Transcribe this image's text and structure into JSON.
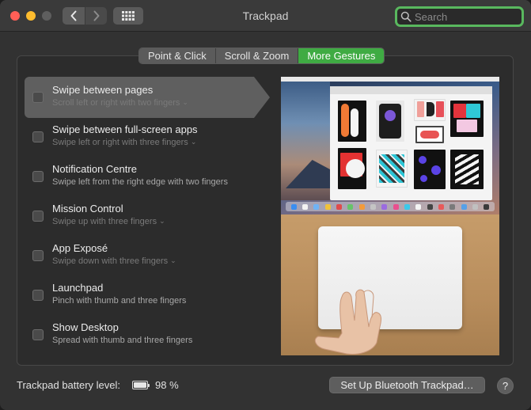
{
  "window": {
    "title": "Trackpad"
  },
  "search": {
    "placeholder": "Search"
  },
  "tabs": [
    {
      "label": "Point & Click",
      "active": false
    },
    {
      "label": "Scroll & Zoom",
      "active": false
    },
    {
      "label": "More Gestures",
      "active": true
    }
  ],
  "gestures": [
    {
      "title": "Swipe between pages",
      "subtitle": "Scroll left or right with two fingers",
      "dropdown": true,
      "selected": true,
      "checked": false
    },
    {
      "title": "Swipe between full-screen apps",
      "subtitle": "Swipe left or right with three fingers",
      "dropdown": true,
      "selected": false,
      "checked": false
    },
    {
      "title": "Notification Centre",
      "subtitle": "Swipe left from the right edge with two fingers",
      "dropdown": false,
      "selected": false,
      "checked": false
    },
    {
      "title": "Mission Control",
      "subtitle": "Swipe up with three fingers",
      "dropdown": true,
      "selected": false,
      "checked": false
    },
    {
      "title": "App Exposé",
      "subtitle": "Swipe down with three fingers",
      "dropdown": true,
      "selected": false,
      "checked": false
    },
    {
      "title": "Launchpad",
      "subtitle": "Pinch with thumb and three fingers",
      "dropdown": false,
      "selected": false,
      "checked": false
    },
    {
      "title": "Show Desktop",
      "subtitle": "Spread with thumb and three fingers",
      "dropdown": false,
      "selected": false,
      "checked": false
    }
  ],
  "footer": {
    "battery_label": "Trackpad battery level:",
    "battery_value": "98 %",
    "battery_level": 0.98,
    "setup_button": "Set Up Bluetooth Trackpad…",
    "help_button": "?"
  },
  "colors": {
    "accent": "#3fab43",
    "search_focus": "#59b85e",
    "close": "#ff5f57",
    "minimize": "#febc2e"
  },
  "icons": [
    "close-icon",
    "minimize-icon",
    "zoom-icon",
    "chevron-left-icon",
    "chevron-right-icon",
    "grid-icon",
    "search-icon",
    "checkbox-icon",
    "chevron-down-icon",
    "battery-icon"
  ]
}
